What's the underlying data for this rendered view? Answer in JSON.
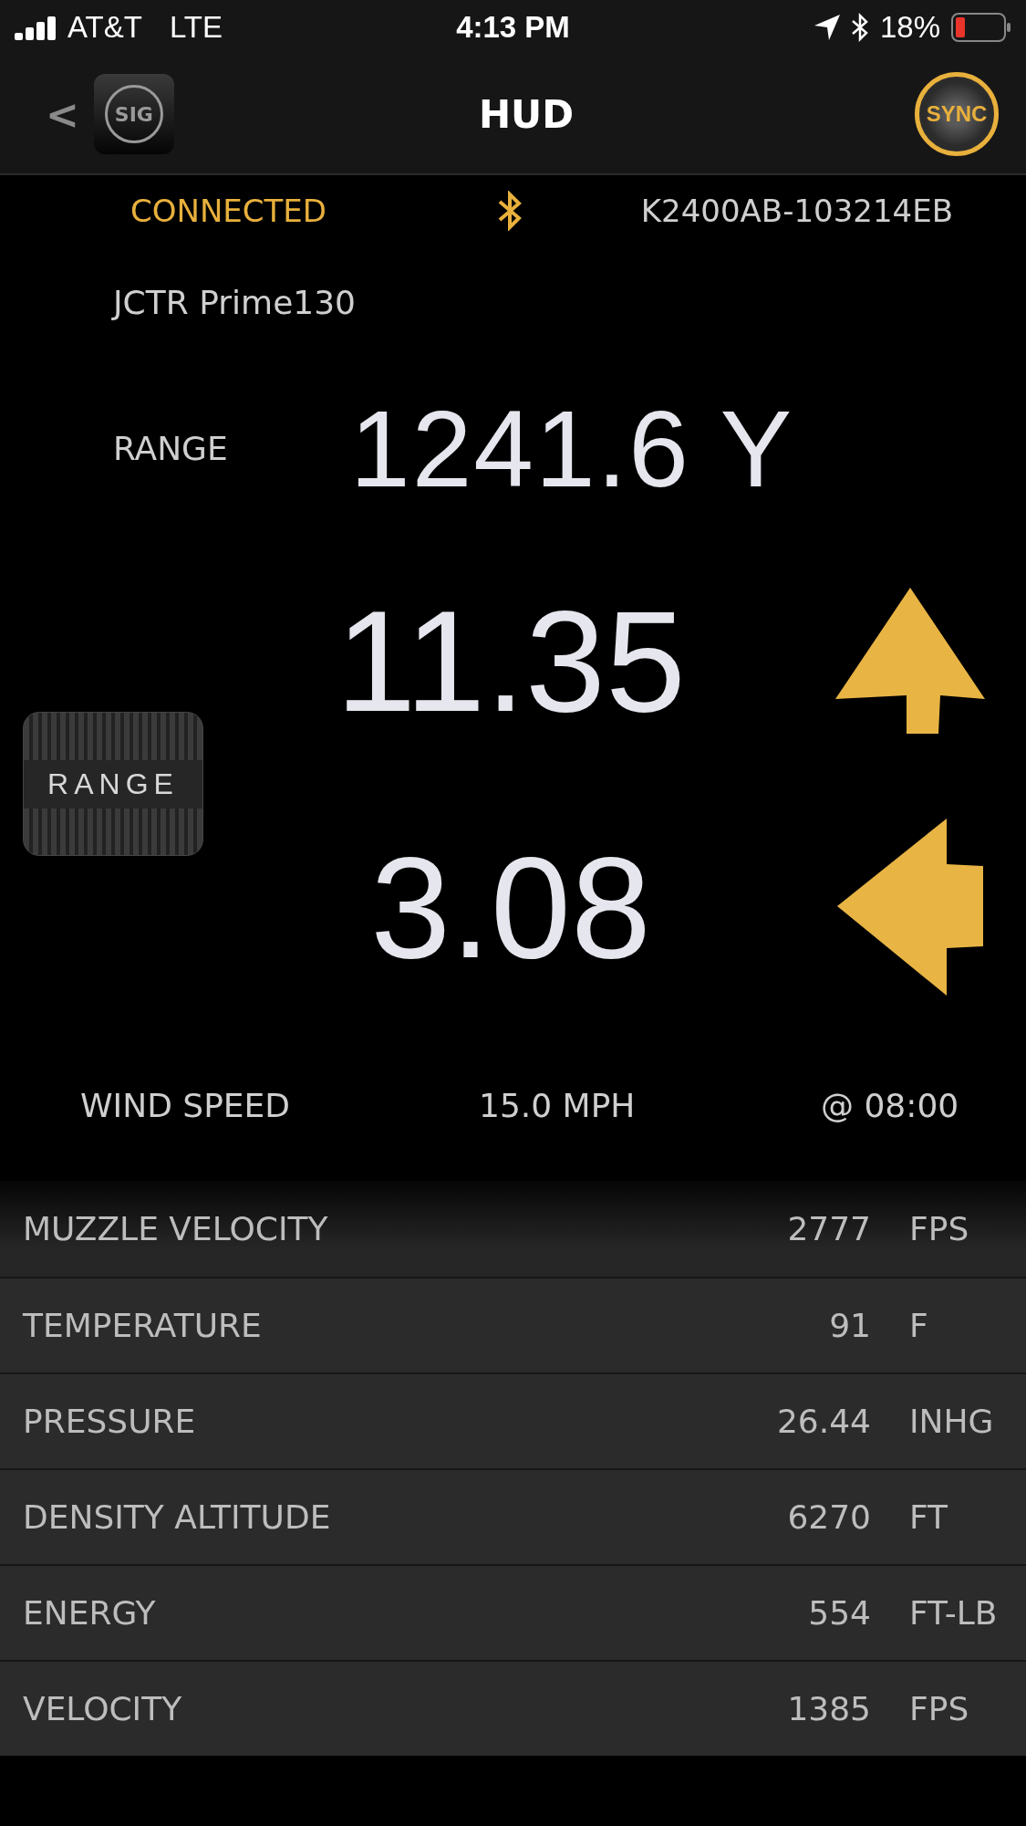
{
  "status_bar": {
    "carrier": "AT&T",
    "network": "LTE",
    "time": "4:13 PM",
    "battery_percent": "18%"
  },
  "nav_bar": {
    "back": "<",
    "logo_text": "SIG",
    "title": "HUD",
    "sync_label": "SYNC"
  },
  "device": {
    "status": "CONNECTED",
    "serial": "K2400AB-103214EB",
    "profile": "JCTR Prime130"
  },
  "range": {
    "label": "RANGE",
    "value": "1241.6 Y"
  },
  "corrections": [
    {
      "value": "11.35",
      "kind": "up"
    },
    {
      "value": "3.08",
      "kind": "left"
    }
  ],
  "range_button": "RANGE",
  "wind": {
    "label": "WIND SPEED",
    "speed": "15.0 MPH",
    "direction": "@ 08:00"
  },
  "readings": [
    {
      "label": "MUZZLE VELOCITY",
      "value": "2777",
      "unit": "FPS"
    },
    {
      "label": "TEMPERATURE",
      "value": "91",
      "unit": "F"
    },
    {
      "label": "PRESSURE",
      "value": "26.44",
      "unit": "INHG"
    },
    {
      "label": "DENSITY ALTITUDE",
      "value": "6270",
      "unit": "FT"
    },
    {
      "label": "ENERGY",
      "value": "554",
      "unit": "FT-LB"
    },
    {
      "label": "VELOCITY",
      "value": "1385",
      "unit": "FPS"
    }
  ]
}
